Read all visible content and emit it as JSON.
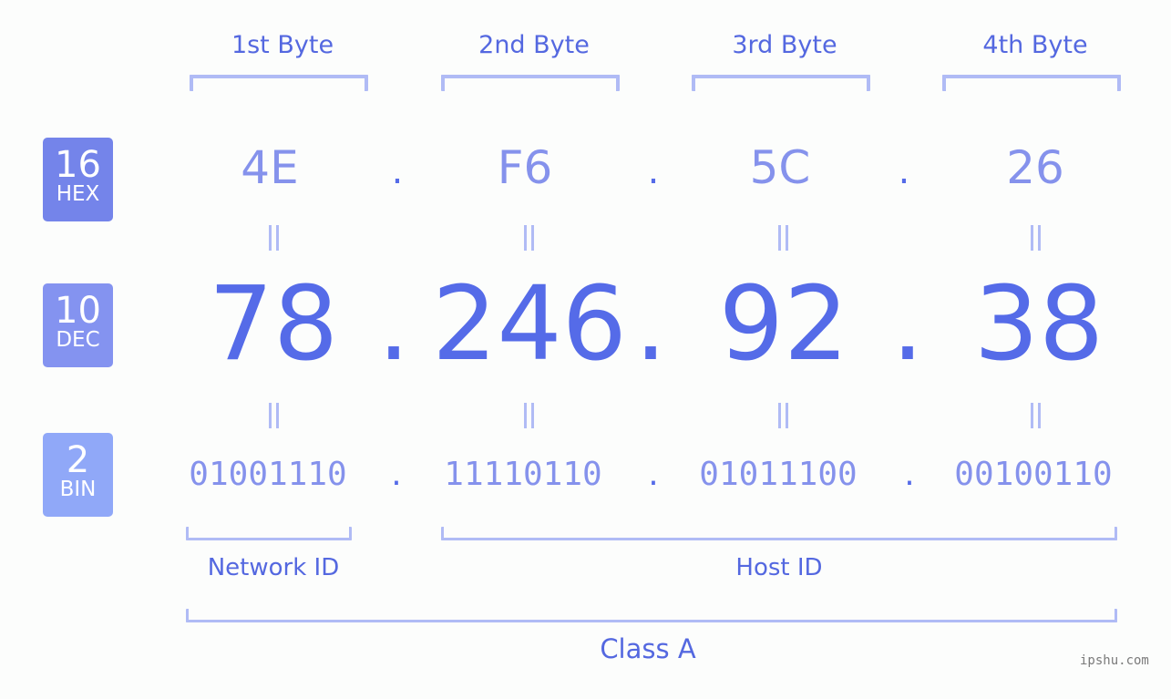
{
  "byte_headers": [
    "1st Byte",
    "2nd Byte",
    "3rd Byte",
    "4th Byte"
  ],
  "badges": [
    {
      "number": "16",
      "label": "HEX",
      "color": "#7484ea"
    },
    {
      "number": "10",
      "label": "DEC",
      "color": "#8493f0"
    },
    {
      "number": "2",
      "label": "BIN",
      "color": "#90a8f8"
    }
  ],
  "hex": [
    "4E",
    "F6",
    "5C",
    "26"
  ],
  "dec": [
    "78",
    "246",
    "92",
    "38"
  ],
  "bin": [
    "01001110",
    "11110110",
    "01011100",
    "00100110"
  ],
  "separator": ".",
  "network_id_label": "Network ID",
  "host_id_label": "Host ID",
  "class_label": "Class A",
  "watermark": "ipshu.com",
  "colors": {
    "accent": "#556be8",
    "light": "#8592ec",
    "bracket": "#b0bbf5"
  }
}
